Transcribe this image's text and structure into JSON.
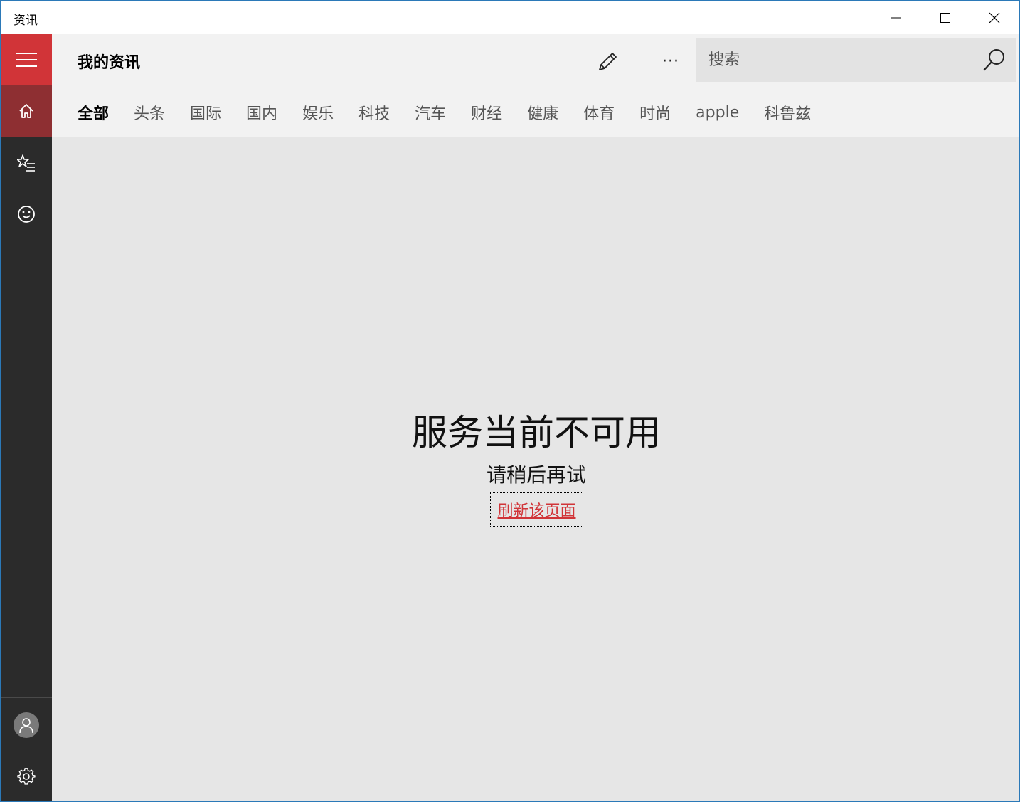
{
  "window": {
    "title": "资讯"
  },
  "header": {
    "page_title": "我的资讯",
    "search_placeholder": "搜索",
    "more_label": "···"
  },
  "tabs": [
    {
      "label": "全部",
      "active": true
    },
    {
      "label": "头条"
    },
    {
      "label": "国际"
    },
    {
      "label": "国内"
    },
    {
      "label": "娱乐"
    },
    {
      "label": "科技"
    },
    {
      "label": "汽车"
    },
    {
      "label": "财经"
    },
    {
      "label": "健康"
    },
    {
      "label": "体育"
    },
    {
      "label": "时尚"
    },
    {
      "label": "apple"
    },
    {
      "label": "科鲁兹"
    }
  ],
  "message": {
    "title": "服务当前不可用",
    "subtitle": "请稍后再试",
    "refresh_link": "刷新该页面"
  },
  "icons": {
    "rail": [
      "hamburger-icon",
      "home-icon",
      "favorites-icon",
      "smile-icon",
      "user-icon",
      "settings-icon"
    ],
    "header": [
      "pencil-icon",
      "more-icon",
      "search-icon"
    ]
  },
  "colors": {
    "accent": "#d13438",
    "accent_dark": "#8e2f32",
    "rail_bg": "#2b2b2b",
    "header_bg": "#f2f2f2",
    "content_bg": "#e6e6e6"
  }
}
